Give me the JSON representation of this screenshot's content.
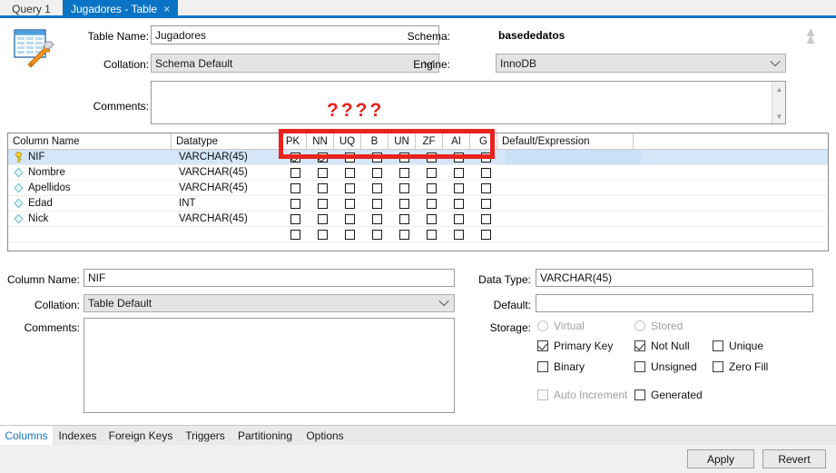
{
  "tabs": {
    "query_tab": "Query 1",
    "active_tab": "Jugadores - Table",
    "close_glyph": "×"
  },
  "table_form": {
    "table_name_label": "Table Name:",
    "table_name_value": "Jugadores",
    "collation_label": "Collation:",
    "collation_value": "Schema Default",
    "comments_label": "Comments:",
    "comments_value": "",
    "schema_label": "Schema:",
    "schema_value": "basededatos",
    "engine_label": "Engine:",
    "engine_value": "InnoDB"
  },
  "annotation": {
    "text": "????",
    "color": "#e8221c"
  },
  "grid": {
    "headers": [
      "Column Name",
      "Datatype",
      "PK",
      "NN",
      "UQ",
      "B",
      "UN",
      "ZF",
      "AI",
      "G",
      "Default/Expression"
    ],
    "rows": [
      {
        "icon": "primary-key-icon",
        "name": "NIF",
        "datatype": "VARCHAR(45)",
        "pk": true,
        "nn": true,
        "uq": false,
        "b": false,
        "un": false,
        "zf": false,
        "ai": false,
        "g": false,
        "default": "",
        "selected": true
      },
      {
        "icon": "column-diamond-icon",
        "name": "Nombre",
        "datatype": "VARCHAR(45)",
        "pk": false,
        "nn": false,
        "uq": false,
        "b": false,
        "un": false,
        "zf": false,
        "ai": false,
        "g": false,
        "default": "",
        "selected": false
      },
      {
        "icon": "column-diamond-icon",
        "name": "Apellidos",
        "datatype": "VARCHAR(45)",
        "pk": false,
        "nn": false,
        "uq": false,
        "b": false,
        "un": false,
        "zf": false,
        "ai": false,
        "g": false,
        "default": "",
        "selected": false
      },
      {
        "icon": "column-diamond-icon",
        "name": "Edad",
        "datatype": "INT",
        "pk": false,
        "nn": false,
        "uq": false,
        "b": false,
        "un": false,
        "zf": false,
        "ai": false,
        "g": false,
        "default": "",
        "selected": false
      },
      {
        "icon": "column-diamond-icon",
        "name": "Nick",
        "datatype": "VARCHAR(45)",
        "pk": false,
        "nn": false,
        "uq": false,
        "b": false,
        "un": false,
        "zf": false,
        "ai": false,
        "g": false,
        "default": "",
        "selected": false
      },
      {
        "icon": "",
        "name": "",
        "datatype": "",
        "pk": false,
        "nn": false,
        "uq": false,
        "b": false,
        "un": false,
        "zf": false,
        "ai": false,
        "g": false,
        "default": "",
        "selected": false
      }
    ]
  },
  "column_detail": {
    "column_name_label": "Column Name:",
    "column_name_value": "NIF",
    "collation_label": "Collation:",
    "collation_value": "Table Default",
    "comments_label": "Comments:",
    "comments_value": "",
    "data_type_label": "Data Type:",
    "data_type_value": "VARCHAR(45)",
    "default_label": "Default:",
    "default_value": "",
    "storage_label": "Storage:",
    "options": {
      "virtual": {
        "label": "Virtual",
        "checked": false,
        "disabled": true
      },
      "stored": {
        "label": "Stored",
        "checked": false,
        "disabled": true
      },
      "primary_key": {
        "label": "Primary Key",
        "checked": true,
        "disabled": false
      },
      "not_null": {
        "label": "Not Null",
        "checked": true,
        "disabled": false
      },
      "unique": {
        "label": "Unique",
        "checked": false,
        "disabled": false
      },
      "binary": {
        "label": "Binary",
        "checked": false,
        "disabled": false
      },
      "unsigned": {
        "label": "Unsigned",
        "checked": false,
        "disabled": false
      },
      "zero_fill": {
        "label": "Zero Fill",
        "checked": false,
        "disabled": false
      },
      "auto_increment": {
        "label": "Auto Increment",
        "checked": false,
        "disabled": true
      },
      "generated": {
        "label": "Generated",
        "checked": false,
        "disabled": false
      }
    }
  },
  "bottom_tabs": [
    {
      "label": "Columns",
      "active": true
    },
    {
      "label": "Indexes",
      "active": false
    },
    {
      "label": "Foreign Keys",
      "active": false
    },
    {
      "label": "Triggers",
      "active": false
    },
    {
      "label": "Partitioning",
      "active": false
    },
    {
      "label": "Options",
      "active": false
    }
  ],
  "buttons": {
    "apply": "Apply",
    "revert": "Revert"
  },
  "colors": {
    "accent_blue": "#0a74c4",
    "selection_blue": "#d4e6f8",
    "annotation_red": "#e8221c"
  }
}
